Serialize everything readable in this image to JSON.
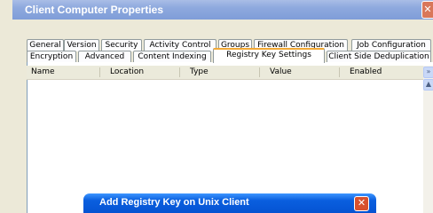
{
  "window": {
    "title": "Client Computer Properties",
    "close_glyph": "✕"
  },
  "tabs_row1": [
    {
      "label": "General"
    },
    {
      "label": "Version"
    },
    {
      "label": "Security"
    },
    {
      "label": "Activity Control"
    },
    {
      "label": "Groups"
    },
    {
      "label": "Firewall Configuration"
    },
    {
      "label": "Job Configuration"
    }
  ],
  "tabs_row2": [
    {
      "label": "Encryption"
    },
    {
      "label": "Advanced"
    },
    {
      "label": "Content Indexing"
    },
    {
      "label": "Registry Key Settings",
      "active": true
    },
    {
      "label": "Client Side Deduplication"
    }
  ],
  "table": {
    "columns": [
      "Name",
      "Location",
      "Type",
      "Value",
      "Enabled"
    ],
    "more_glyph": "»"
  },
  "scrollbar": {
    "up_glyph": "▲"
  },
  "dialog": {
    "title": "Add Registry Key on Unix Client",
    "close_glyph": "✕"
  }
}
